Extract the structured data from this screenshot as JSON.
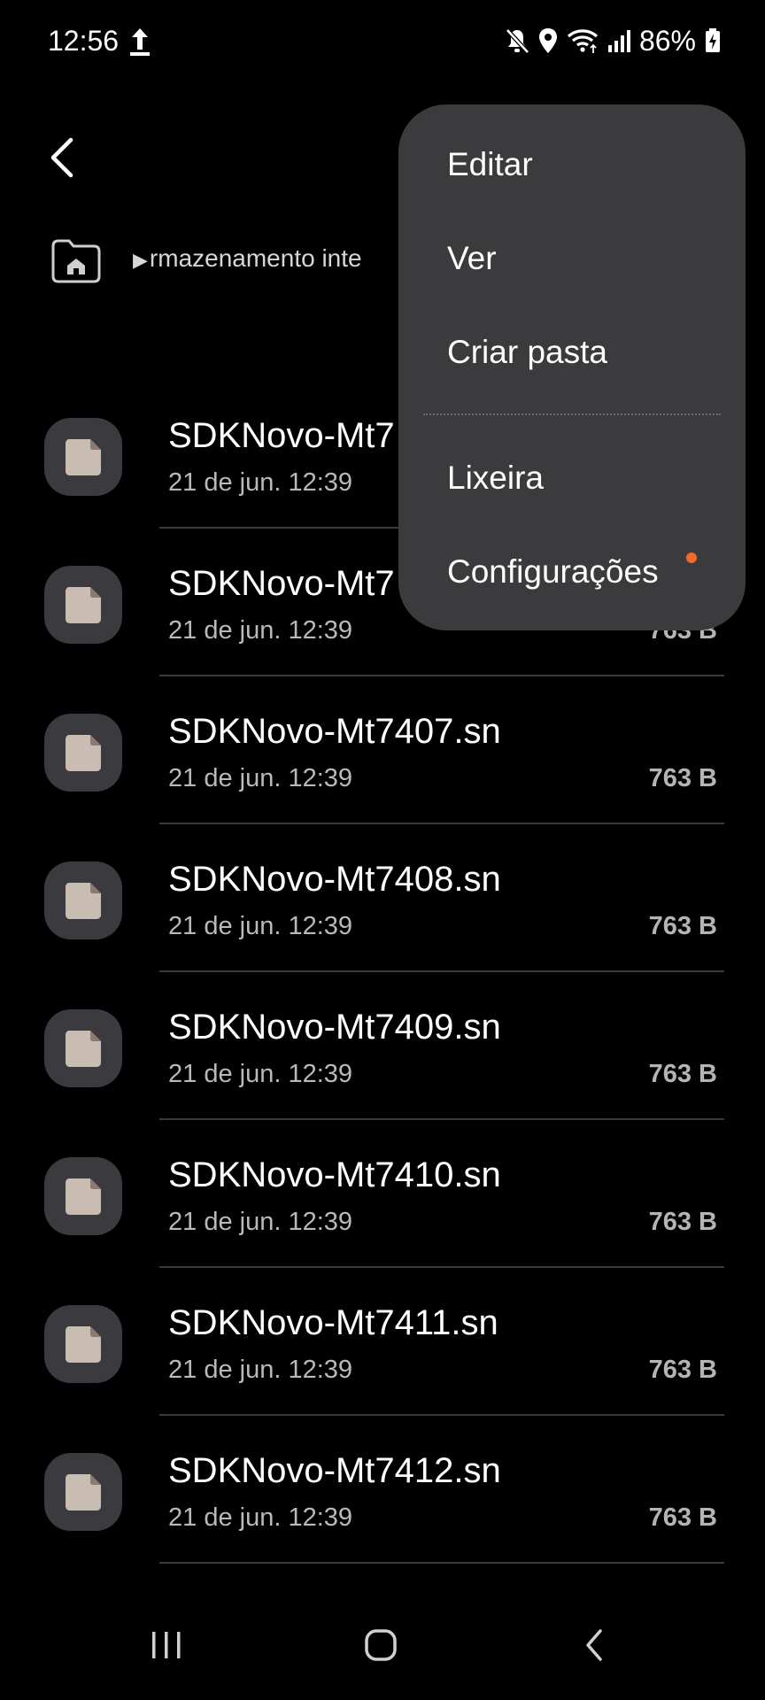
{
  "status_bar": {
    "time": "12:56",
    "battery": "86%",
    "icons": [
      "upload-icon",
      "mute-icon",
      "location-icon",
      "wifi-icon",
      "signal-icon",
      "battery-icon"
    ]
  },
  "header": {
    "back_icon": "chevron-left-icon"
  },
  "breadcrumb": {
    "home_icon": "home-folder-icon",
    "path": "rmazenamento inte"
  },
  "menu": {
    "items": [
      {
        "label": "Editar"
      },
      {
        "label": "Ver"
      },
      {
        "label": "Criar pasta"
      },
      {
        "label": "Lixeira"
      },
      {
        "label": "Configurações",
        "badge_color": "#f26b2c"
      }
    ]
  },
  "files": [
    {
      "name": "SDKNovo-Mt7",
      "date": "21 de jun. 12:39",
      "size": ""
    },
    {
      "name": "SDKNovo-Mt7",
      "date": "21 de jun. 12:39",
      "size": "763 B"
    },
    {
      "name": "SDKNovo-Mt7407.sn",
      "date": "21 de jun. 12:39",
      "size": "763 B"
    },
    {
      "name": "SDKNovo-Mt7408.sn",
      "date": "21 de jun. 12:39",
      "size": "763 B"
    },
    {
      "name": "SDKNovo-Mt7409.sn",
      "date": "21 de jun. 12:39",
      "size": "763 B"
    },
    {
      "name": "SDKNovo-Mt7410.sn",
      "date": "21 de jun. 12:39",
      "size": "763 B"
    },
    {
      "name": "SDKNovo-Mt7411.sn",
      "date": "21 de jun. 12:39",
      "size": "763 B"
    },
    {
      "name": "SDKNovo-Mt7412.sn",
      "date": "21 de jun. 12:39",
      "size": "763 B"
    }
  ],
  "nav_bar": {
    "icons": [
      "recents-icon",
      "home-icon",
      "back-icon"
    ]
  },
  "colors": {
    "background": "#000000",
    "menu_background": "#3b3b3e",
    "file_icon_tile": "#3b3a3f",
    "file_icon_page": "#c9bdb3",
    "badge": "#f26b2c"
  }
}
